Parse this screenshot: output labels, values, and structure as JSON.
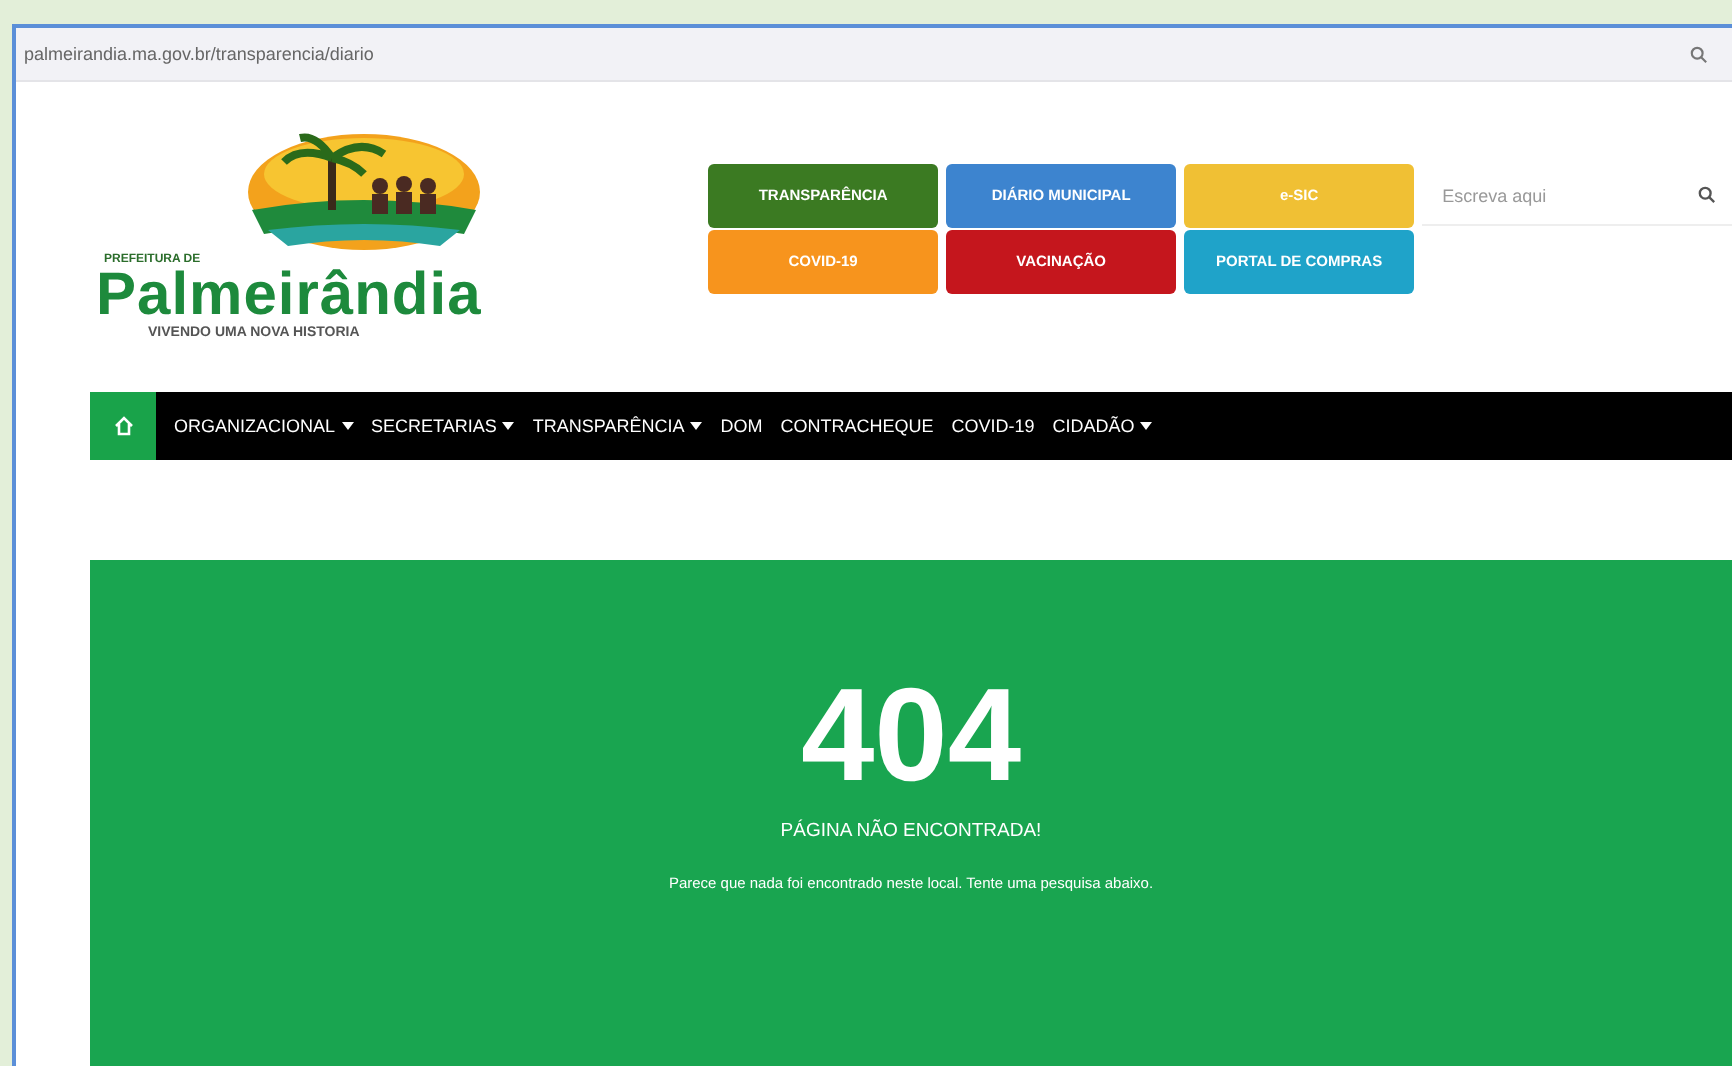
{
  "address_bar": {
    "url": "palmeirandia.ma.gov.br/transparencia/diario"
  },
  "logo": {
    "prefix": "PREFEITURA DE",
    "name": "Palmeirândia",
    "slogan": "VIVENDO UMA NOVA HISTORIA"
  },
  "quick_links": [
    {
      "label": "TRANSPARÊNCIA",
      "color": "#3b7a22"
    },
    {
      "label": "DIÁRIO MUNICIPAL",
      "color": "#3d84cf"
    },
    {
      "label": "e-SIC",
      "color": "#f0c034"
    },
    {
      "label": "COVID-19",
      "color": "#f7941d"
    },
    {
      "label": "VACINAÇÃO",
      "color": "#c5161d"
    },
    {
      "label": "PORTAL DE COMPRAS",
      "color": "#1fa3c9"
    }
  ],
  "search": {
    "placeholder": "Escreva aqui"
  },
  "nav": [
    {
      "label": "ORGANIZACIONAL",
      "has_menu": true
    },
    {
      "label": "SECRETARIAS",
      "has_menu": true
    },
    {
      "label": "TRANSPARÊNCIA",
      "has_menu": true
    },
    {
      "label": "DOM",
      "has_menu": false
    },
    {
      "label": "CONTRACHEQUE",
      "has_menu": false
    },
    {
      "label": "COVID-19",
      "has_menu": false
    },
    {
      "label": "CIDADÃO",
      "has_menu": true
    }
  ],
  "error": {
    "code": "404",
    "title": "PÁGINA NÃO ENCONTRADA!",
    "message": "Parece que nada foi encontrado neste local. Tente uma pesquisa abaixo."
  }
}
